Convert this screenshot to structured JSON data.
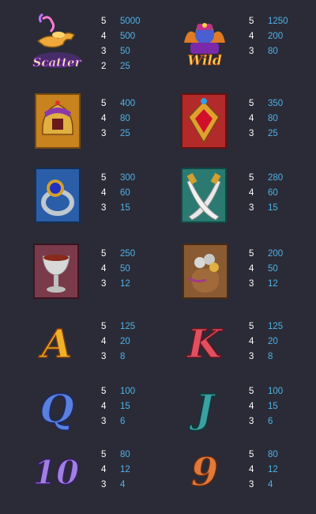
{
  "symbols": [
    {
      "name": "Scatter",
      "label": "Scatter",
      "pays": [
        {
          "count": "5",
          "amount": "5000"
        },
        {
          "count": "4",
          "amount": "500"
        },
        {
          "count": "3",
          "amount": "50"
        },
        {
          "count": "2",
          "amount": "25"
        }
      ]
    },
    {
      "name": "Wild",
      "label": "Wild",
      "pays": [
        {
          "count": "5",
          "amount": "1250"
        },
        {
          "count": "4",
          "amount": "200"
        },
        {
          "count": "3",
          "amount": "80"
        }
      ]
    },
    {
      "name": "Helmet",
      "pays": [
        {
          "count": "5",
          "amount": "400"
        },
        {
          "count": "4",
          "amount": "80"
        },
        {
          "count": "3",
          "amount": "25"
        }
      ]
    },
    {
      "name": "Ruby Amulet",
      "pays": [
        {
          "count": "5",
          "amount": "350"
        },
        {
          "count": "4",
          "amount": "80"
        },
        {
          "count": "3",
          "amount": "25"
        }
      ]
    },
    {
      "name": "Ring",
      "pays": [
        {
          "count": "5",
          "amount": "300"
        },
        {
          "count": "4",
          "amount": "60"
        },
        {
          "count": "3",
          "amount": "15"
        }
      ]
    },
    {
      "name": "Scimitars",
      "pays": [
        {
          "count": "5",
          "amount": "280"
        },
        {
          "count": "4",
          "amount": "60"
        },
        {
          "count": "3",
          "amount": "15"
        }
      ]
    },
    {
      "name": "Goblet",
      "pays": [
        {
          "count": "5",
          "amount": "250"
        },
        {
          "count": "4",
          "amount": "50"
        },
        {
          "count": "3",
          "amount": "12"
        }
      ]
    },
    {
      "name": "Coin Pouch",
      "pays": [
        {
          "count": "5",
          "amount": "200"
        },
        {
          "count": "4",
          "amount": "50"
        },
        {
          "count": "3",
          "amount": "12"
        }
      ]
    },
    {
      "name": "A",
      "label": "A",
      "pays": [
        {
          "count": "5",
          "amount": "125"
        },
        {
          "count": "4",
          "amount": "20"
        },
        {
          "count": "3",
          "amount": "8"
        }
      ]
    },
    {
      "name": "K",
      "label": "K",
      "pays": [
        {
          "count": "5",
          "amount": "125"
        },
        {
          "count": "4",
          "amount": "20"
        },
        {
          "count": "3",
          "amount": "8"
        }
      ]
    },
    {
      "name": "Q",
      "label": "Q",
      "pays": [
        {
          "count": "5",
          "amount": "100"
        },
        {
          "count": "4",
          "amount": "15"
        },
        {
          "count": "3",
          "amount": "6"
        }
      ]
    },
    {
      "name": "J",
      "label": "J",
      "pays": [
        {
          "count": "5",
          "amount": "100"
        },
        {
          "count": "4",
          "amount": "15"
        },
        {
          "count": "3",
          "amount": "6"
        }
      ]
    },
    {
      "name": "10",
      "label": "10",
      "pays": [
        {
          "count": "5",
          "amount": "80"
        },
        {
          "count": "4",
          "amount": "12"
        },
        {
          "count": "3",
          "amount": "4"
        }
      ]
    },
    {
      "name": "9",
      "label": "9",
      "pays": [
        {
          "count": "5",
          "amount": "80"
        },
        {
          "count": "4",
          "amount": "12"
        },
        {
          "count": "3",
          "amount": "4"
        }
      ]
    }
  ],
  "colors": {
    "background": "#2a2b36",
    "count": "#ffffff",
    "amount": "#4fb3e8"
  }
}
